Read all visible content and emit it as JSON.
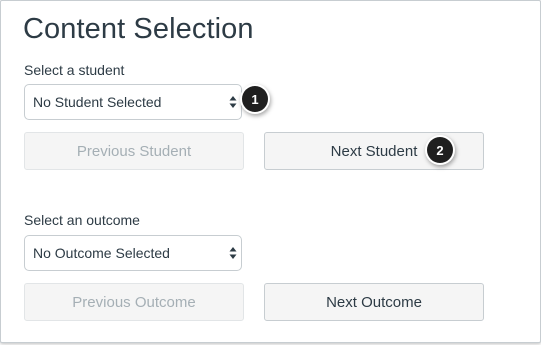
{
  "page": {
    "title": "Content Selection"
  },
  "student": {
    "label": "Select a student",
    "select_value": "No Student Selected",
    "previous_label": "Previous Student",
    "next_label": "Next Student"
  },
  "outcome": {
    "label": "Select an outcome",
    "select_value": "No Outcome Selected",
    "previous_label": "Previous Outcome",
    "next_label": "Next Outcome"
  },
  "callouts": [
    "1",
    "2"
  ],
  "colors": {
    "text": "#2d3b45",
    "disabled_text": "#a5afb5",
    "border": "#c7cdd1",
    "button_bg": "#f5f5f5",
    "callout_bg": "#1f1f1f"
  },
  "icons": {
    "select_arrows": "up-down-arrows-icon"
  }
}
